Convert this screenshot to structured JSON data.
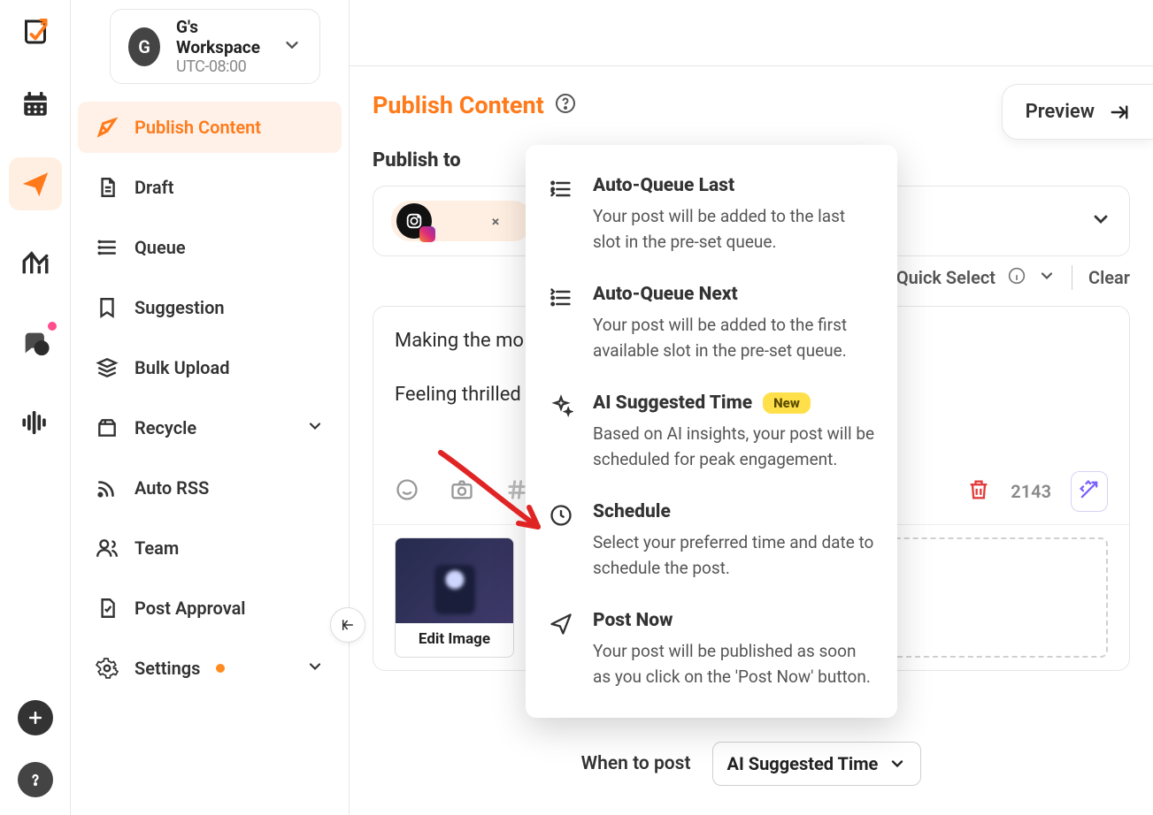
{
  "workspace": {
    "initial": "G",
    "name": "G's Workspace",
    "tz": "UTC-08:00"
  },
  "nav": {
    "publish": "Publish Content",
    "draft": "Draft",
    "queue": "Queue",
    "suggestion": "Suggestion",
    "bulk": "Bulk Upload",
    "recycle": "Recycle",
    "rss": "Auto RSS",
    "team": "Team",
    "approval": "Post Approval",
    "settings": "Settings"
  },
  "page": {
    "title": "Publish Content",
    "preview": "Preview",
    "publish_to": "Publish to",
    "quick_select": "Quick Select",
    "clear": "Clear"
  },
  "composer": {
    "line1": "Making the mo",
    "line2": "Feeling thrilled",
    "char_count": "2143",
    "edit_image": "Edit Image"
  },
  "when": {
    "label": "When to post",
    "selected": "AI Suggested Time"
  },
  "menu": {
    "aq_last_t": "Auto-Queue Last",
    "aq_last_d": "Your post will be added to the last slot in the pre-set queue.",
    "aq_next_t": "Auto-Queue Next",
    "aq_next_d": "Your post will be added to the first available slot in the pre-set queue.",
    "ai_t": "AI Suggested Time",
    "ai_badge": "New",
    "ai_d": "Based on AI insights, your post will be scheduled for peak engagement.",
    "sched_t": "Schedule",
    "sched_d": "Select your preferred time and date to schedule the post.",
    "now_t": "Post Now",
    "now_d": "Your post will be published as soon as you click on the 'Post Now' button."
  }
}
